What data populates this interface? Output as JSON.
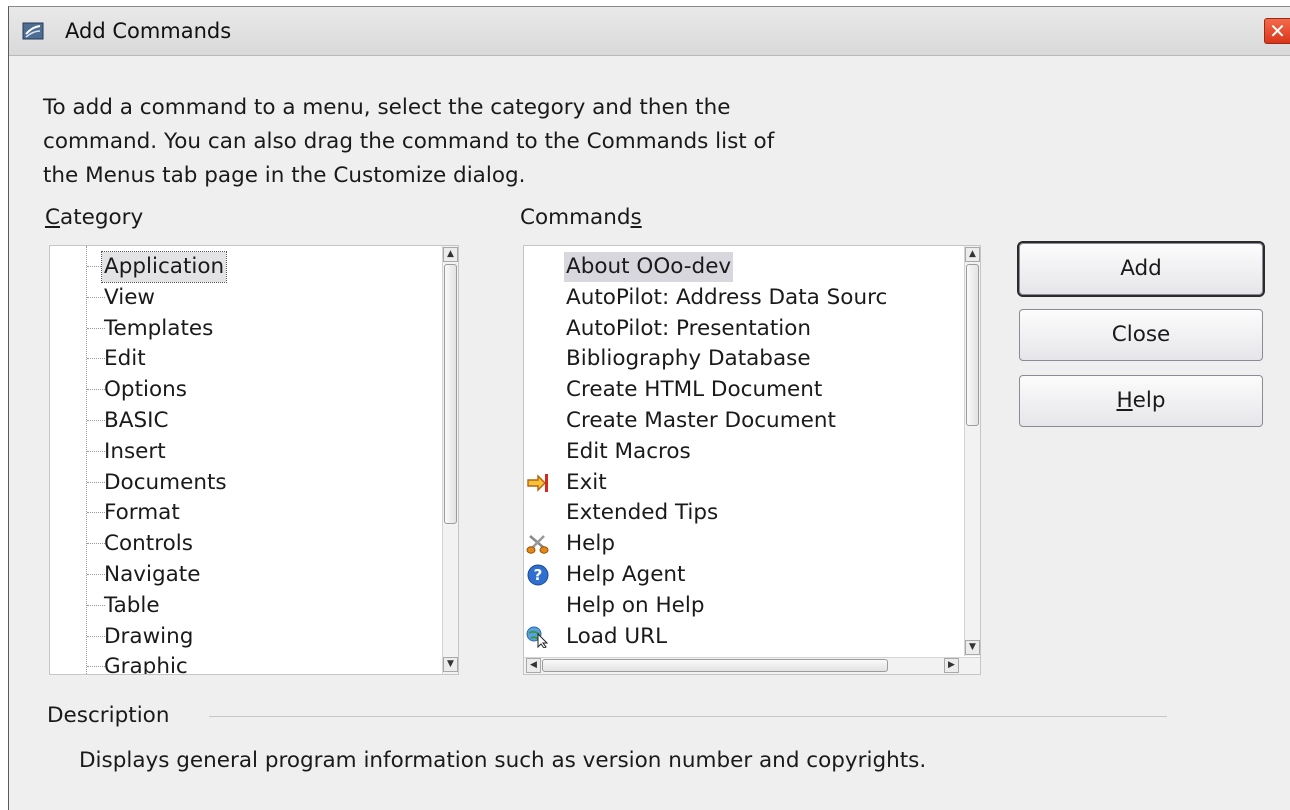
{
  "window": {
    "title": "Add Commands",
    "close_glyph": "✕"
  },
  "intro_lines": [
    "To add a command to a menu, select the category and then the",
    "command. You can also drag the command to the Commands list of",
    "the Menus tab page in the Customize dialog."
  ],
  "category": {
    "label": "Category",
    "items": [
      "Application",
      "View",
      "Templates",
      "Edit",
      "Options",
      "BASIC",
      "Insert",
      "Documents",
      "Format",
      "Controls",
      "Navigate",
      "Table",
      "Drawing",
      "Graphic"
    ],
    "selected": "Application"
  },
  "commands": {
    "label": "Commands",
    "items": [
      {
        "label": "About OOo-dev",
        "icon": "none"
      },
      {
        "label": "AutoPilot: Address Data Sourc",
        "icon": "none"
      },
      {
        "label": "AutoPilot: Presentation",
        "icon": "none"
      },
      {
        "label": "Bibliography Database",
        "icon": "none"
      },
      {
        "label": "Create HTML Document",
        "icon": "none"
      },
      {
        "label": "Create Master Document",
        "icon": "none"
      },
      {
        "label": "Edit Macros",
        "icon": "none"
      },
      {
        "label": "Exit",
        "icon": "exit-arrow-icon"
      },
      {
        "label": "Extended Tips",
        "icon": "none"
      },
      {
        "label": "Help",
        "icon": "scissors-icon"
      },
      {
        "label": "Help Agent",
        "icon": "help-question-icon"
      },
      {
        "label": "Help on Help",
        "icon": "none"
      },
      {
        "label": "Load URL",
        "icon": "load-url-icon"
      }
    ],
    "selected": "About OOo-dev"
  },
  "buttons": {
    "add": "Add",
    "close": "Close",
    "help": "Help"
  },
  "description": {
    "label": "Description",
    "text": "Displays general program information such as version number and copyrights."
  },
  "colors": {
    "selection": "#d7d7dd",
    "close_button": "#e04424",
    "window_bg": "#efefef"
  }
}
